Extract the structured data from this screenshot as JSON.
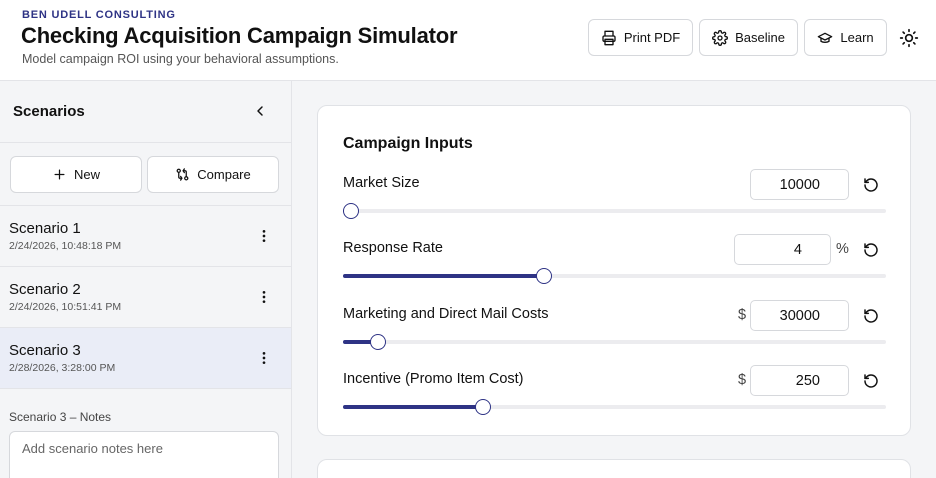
{
  "header": {
    "brand": "BEN UDELL CONSULTING",
    "title": "Checking Acquisition Campaign Simulator",
    "subtitle": "Model campaign ROI using your behavioral assumptions.",
    "buttons": {
      "print": "Print PDF",
      "baseline": "Baseline",
      "learn": "Learn"
    }
  },
  "sidebar": {
    "title": "Scenarios",
    "new_label": "New",
    "compare_label": "Compare",
    "scenarios": [
      {
        "name": "Scenario 1",
        "date": "2/24/2026, 10:48:18 PM"
      },
      {
        "name": "Scenario 2",
        "date": "2/24/2026, 10:51:41 PM"
      },
      {
        "name": "Scenario 3",
        "date": "2/28/2026, 3:28:00 PM"
      }
    ],
    "active_index": 2,
    "notes_label": "Scenario 3 – Notes",
    "notes_placeholder": "Add scenario notes here"
  },
  "inputs": {
    "title": "Campaign Inputs",
    "fields": [
      {
        "label": "Market Size",
        "value": "10000",
        "prefix": "",
        "suffix": "",
        "level": 0.015
      },
      {
        "label": "Response Rate",
        "value": "4",
        "prefix": "",
        "suffix": "%",
        "level": 0.37
      },
      {
        "label": "Marketing and Direct Mail Costs",
        "value": "30000",
        "prefix": "$",
        "suffix": "",
        "level": 0.065
      },
      {
        "label": "Incentive (Promo Item Cost)",
        "value": "250",
        "prefix": "$",
        "suffix": "",
        "level": 0.257
      }
    ]
  },
  "colors": {
    "accent": "#2e3385",
    "active_row": "#eaedf7"
  }
}
